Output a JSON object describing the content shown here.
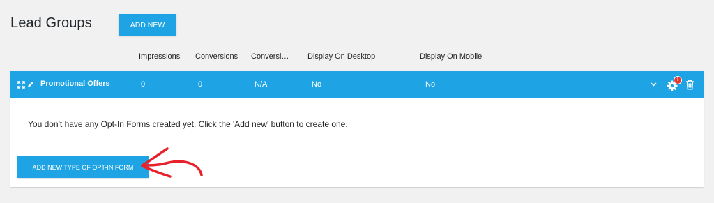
{
  "header": {
    "title": "Lead Groups",
    "add_new_label": "ADD NEW"
  },
  "columns": [
    "Impressions",
    "Conversions",
    "Conversio…",
    "Display On Desktop",
    "Display On Mobile"
  ],
  "group": {
    "name": "Promotional Offers",
    "impressions": "0",
    "conversions": "0",
    "conversion_rate": "N/A",
    "display_desktop": "No",
    "display_mobile": "No",
    "notification_badge": "!",
    "empty_message": "You don't have any Opt-In Forms created yet. Click the 'Add new' button to create one.",
    "add_type_label": "ADD NEW TYPE OF OPT-IN FORM"
  },
  "colors": {
    "accent": "#1ea4e4",
    "badge": "#e53935",
    "annotation_arrow": "#e8202a"
  }
}
